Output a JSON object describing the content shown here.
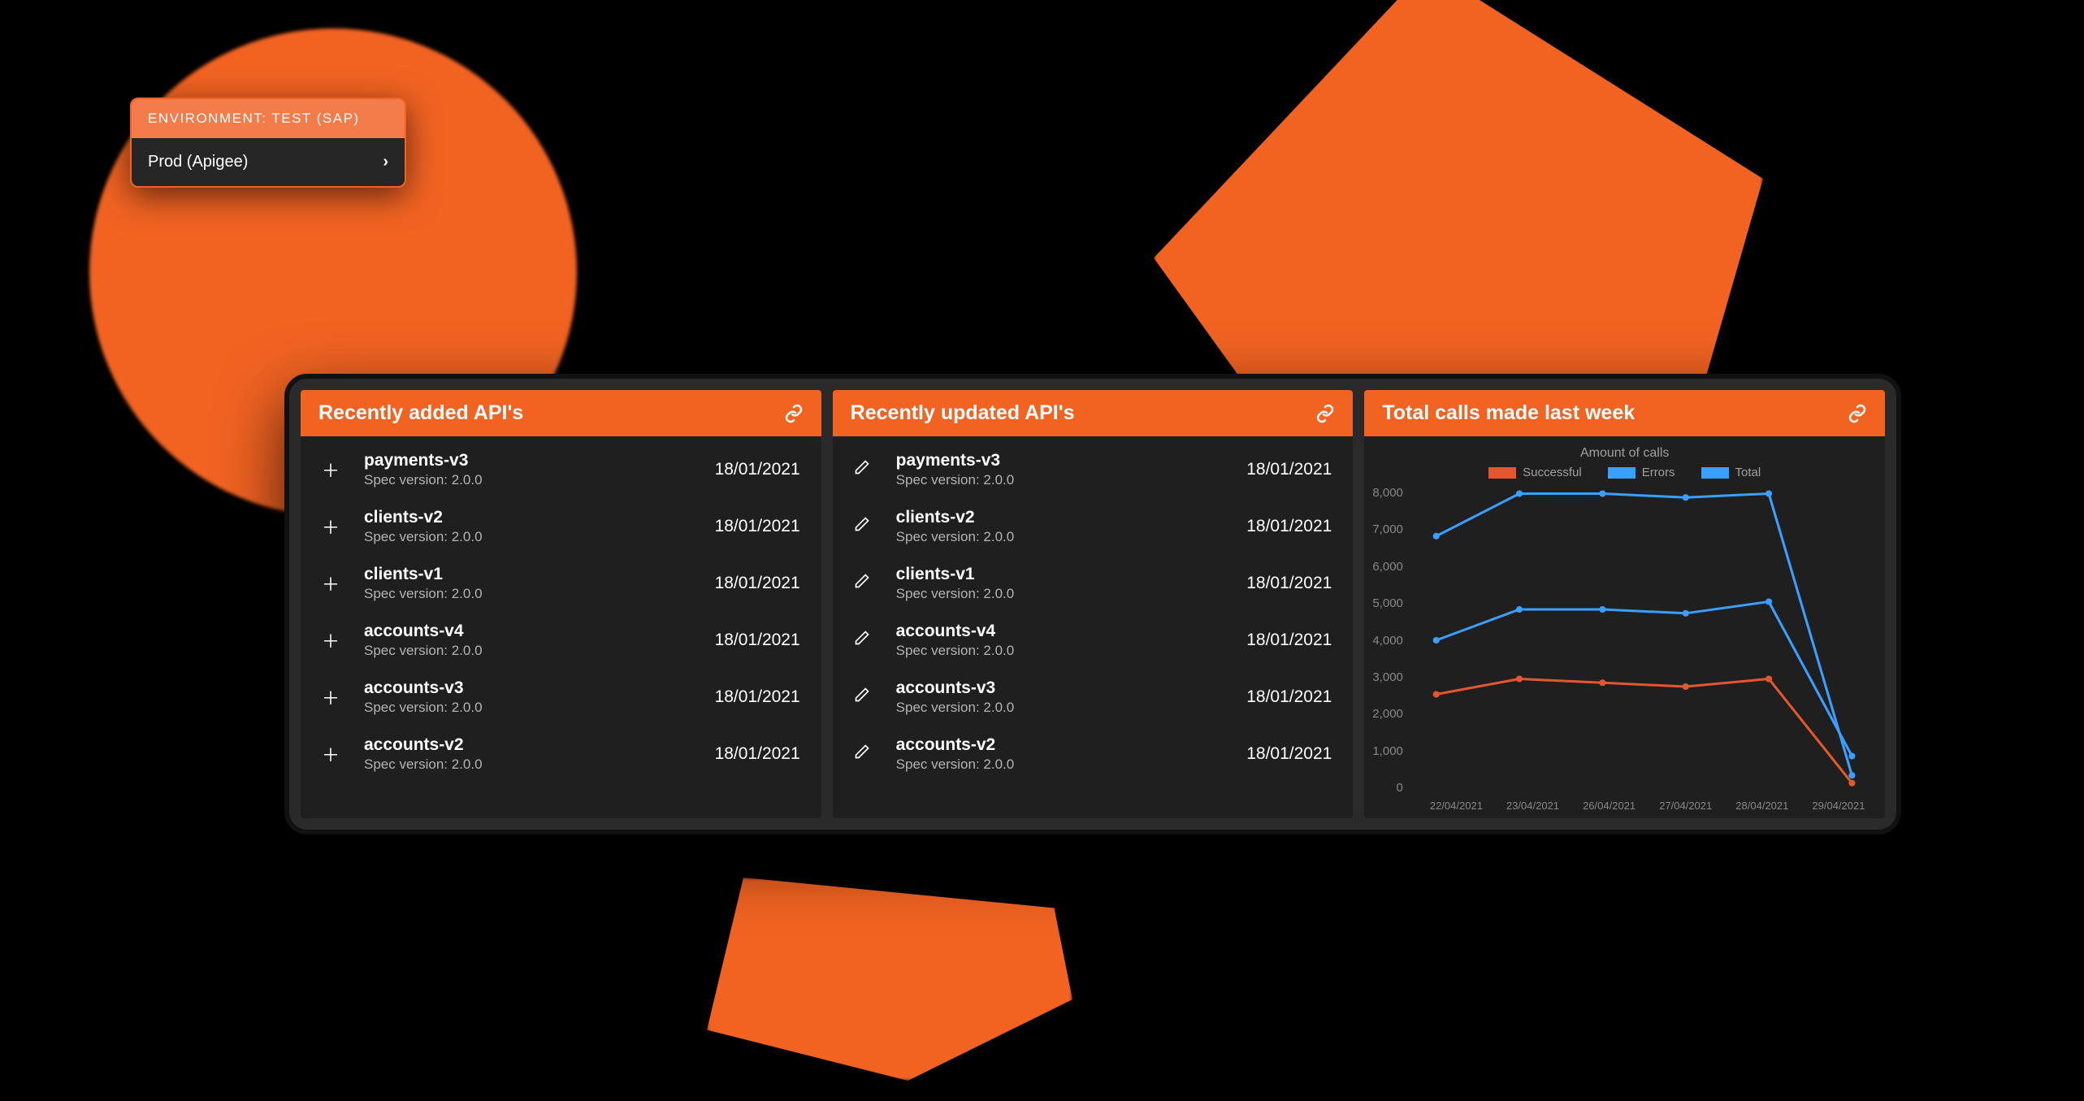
{
  "colors": {
    "accent": "#f26322",
    "red": "#e4572e",
    "blue": "#3aa0ff"
  },
  "env": {
    "header": "ENVIRONMENT: TEST (SAP)",
    "item": "Prod (Apigee)"
  },
  "cards": {
    "added": {
      "title": "Recently added API's",
      "items": [
        {
          "name": "payments-v3",
          "spec": "Spec version: 2.0.0",
          "date": "18/01/2021"
        },
        {
          "name": "clients-v2",
          "spec": "Spec version: 2.0.0",
          "date": "18/01/2021"
        },
        {
          "name": "clients-v1",
          "spec": "Spec version: 2.0.0",
          "date": "18/01/2021"
        },
        {
          "name": "accounts-v4",
          "spec": "Spec version: 2.0.0",
          "date": "18/01/2021"
        },
        {
          "name": "accounts-v3",
          "spec": "Spec version: 2.0.0",
          "date": "18/01/2021"
        },
        {
          "name": "accounts-v2",
          "spec": "Spec version: 2.0.0",
          "date": "18/01/2021"
        }
      ]
    },
    "updated": {
      "title": "Recently updated API's",
      "items": [
        {
          "name": "payments-v3",
          "spec": "Spec version: 2.0.0",
          "date": "18/01/2021"
        },
        {
          "name": "clients-v2",
          "spec": "Spec version: 2.0.0",
          "date": "18/01/2021"
        },
        {
          "name": "clients-v1",
          "spec": "Spec version: 2.0.0",
          "date": "18/01/2021"
        },
        {
          "name": "accounts-v4",
          "spec": "Spec version: 2.0.0",
          "date": "18/01/2021"
        },
        {
          "name": "accounts-v3",
          "spec": "Spec version: 2.0.0",
          "date": "18/01/2021"
        },
        {
          "name": "accounts-v2",
          "spec": "Spec version: 2.0.0",
          "date": "18/01/2021"
        }
      ]
    },
    "calls": {
      "title": "Total calls made last week"
    }
  },
  "chart_data": {
    "type": "line",
    "title": "Amount of calls",
    "ylabel": "",
    "xlabel": "",
    "ylim": [
      0,
      8000
    ],
    "y_ticks": [
      8000,
      7000,
      6000,
      5000,
      4000,
      3000,
      2000,
      1000,
      0
    ],
    "categories": [
      "22/04/2021",
      "23/04/2021",
      "26/04/2021",
      "27/04/2021",
      "28/04/2021",
      "29/04/2021"
    ],
    "series": [
      {
        "name": "Successful",
        "color": "#e4572e",
        "values": [
          2600,
          3000,
          2900,
          2800,
          3000,
          300
        ]
      },
      {
        "name": "Errors",
        "color": "#3aa0ff",
        "values": [
          4000,
          4800,
          4800,
          4700,
          5000,
          1000
        ]
      },
      {
        "name": "Total",
        "color": "#3aa0ff",
        "values": [
          6700,
          7800,
          7800,
          7700,
          7800,
          500
        ]
      }
    ]
  }
}
